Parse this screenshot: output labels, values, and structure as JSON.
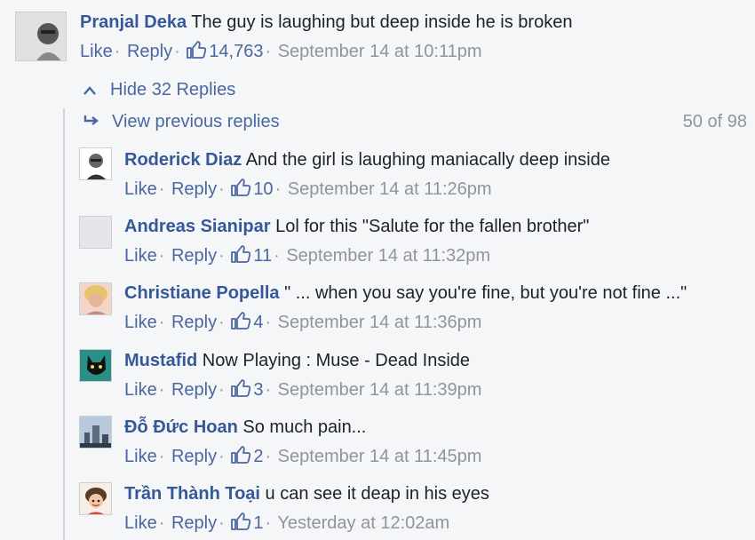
{
  "main_comment": {
    "author": "Pranjal Deka",
    "text": "The guy is laughing but deep inside he is broken",
    "like_label": "Like",
    "reply_label": "Reply",
    "likes": "14,763",
    "timestamp": "September 14 at 10:11pm"
  },
  "thread": {
    "hide_replies": "Hide 32 Replies",
    "view_previous": "View previous replies",
    "counter": "50 of 98"
  },
  "replies": [
    {
      "author": "Roderick Diaz",
      "text": "And the girl is laughing maniacally deep inside",
      "like_label": "Like",
      "reply_label": "Reply",
      "likes": "10",
      "timestamp": "September 14 at 11:26pm"
    },
    {
      "author": "Andreas Sianipar",
      "text": "Lol for this \"Salute for the fallen brother\"",
      "like_label": "Like",
      "reply_label": "Reply",
      "likes": "11",
      "timestamp": "September 14 at 11:32pm"
    },
    {
      "author": "Christiane Popella",
      "text": "\" ... when you say you're fine, but you're not fine ...\"",
      "like_label": "Like",
      "reply_label": "Reply",
      "likes": "4",
      "timestamp": "September 14 at 11:36pm"
    },
    {
      "author": "Mustafid",
      "text": "Now Playing : Muse - Dead Inside",
      "like_label": "Like",
      "reply_label": "Reply",
      "likes": "3",
      "timestamp": "September 14 at 11:39pm"
    },
    {
      "author": "Đỗ Đức Hoan",
      "text": "So much pain...",
      "like_label": "Like",
      "reply_label": "Reply",
      "likes": "2",
      "timestamp": "September 14 at 11:45pm"
    },
    {
      "author": "Trần Thành Toại",
      "text": "u can see it deap in his eyes",
      "like_label": "Like",
      "reply_label": "Reply",
      "likes": "1",
      "timestamp": "Yesterday at 12:02am"
    }
  ],
  "icons": {
    "like": "thumbs-up-icon",
    "hide": "chevron-up-icon",
    "view_previous": "reply-arrow-icon"
  },
  "colors": {
    "name": "#365899",
    "link": "#4b67a1",
    "meta": "#90949c",
    "background": "#f5f6f7"
  }
}
